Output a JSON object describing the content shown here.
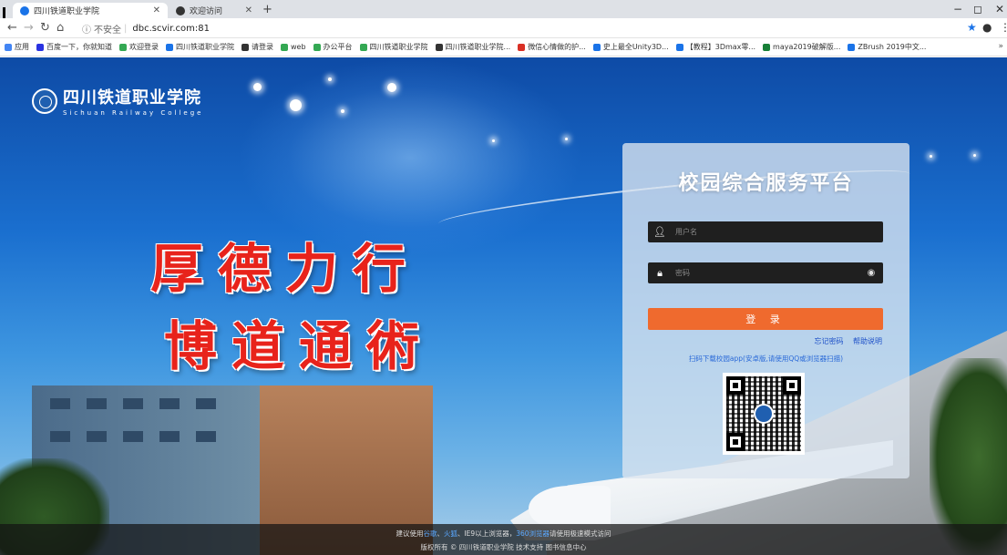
{
  "tabs": [
    {
      "title": "四川铁道职业学院",
      "favicon_color": "#1a73e8"
    },
    {
      "title": "欢迎访问",
      "favicon_color": "#333333"
    }
  ],
  "window_controls": {
    "minimize": "−",
    "maximize": "◻",
    "close": "✕"
  },
  "address": {
    "security": "不安全",
    "url": "dbc.scvir.com:81"
  },
  "bookmarks": [
    {
      "label": "应用",
      "color": "#4285f4"
    },
    {
      "label": "百度一下，你就知道",
      "color": "#2932e1"
    },
    {
      "label": "欢迎登录",
      "color": "#34a853"
    },
    {
      "label": "四川铁道职业学院",
      "color": "#1a73e8"
    },
    {
      "label": "请登录",
      "color": "#333333"
    },
    {
      "label": "web",
      "color": "#34a853"
    },
    {
      "label": "办公平台",
      "color": "#34a853"
    },
    {
      "label": "四川铁道职业学院",
      "color": "#34a853"
    },
    {
      "label": "四川铁道职业学院...",
      "color": "#333333"
    },
    {
      "label": "微信心情做的护...",
      "color": "#d93025"
    },
    {
      "label": "史上最全Unity3D...",
      "color": "#1a73e8"
    },
    {
      "label": "【教程】3Dmax零...",
      "color": "#1a73e8"
    },
    {
      "label": "maya2019破解版...",
      "color": "#188038"
    },
    {
      "label": "ZBrush 2019中文...",
      "color": "#1a73e8"
    }
  ],
  "bookmarks_more": "»",
  "logo": {
    "cn": "四川铁道职业学院",
    "en": "Sichuan Railway College"
  },
  "slogan": {
    "line1": "厚德力行",
    "line2": "博道通術"
  },
  "login": {
    "title": "校园综合服务平台",
    "username_placeholder": "用户名",
    "password_placeholder": "密码",
    "login_button": "登 录",
    "forgot_password": "忘记密码",
    "help": "帮助说明",
    "app_tip": "扫码下载校园app(安卓版,请使用QQ或浏览器扫描)"
  },
  "footer": {
    "line1_prefix": "建议使用",
    "browser1": "谷歌",
    "sep1": "、",
    "browser2": "火狐",
    "line1_mid": "、IE9以上浏览器，",
    "browser3": "360浏览器",
    "line1_suffix": "请使用极速模式访问",
    "line2": "版权所有 © 四川铁道职业学院 技术支持 图书信息中心"
  }
}
